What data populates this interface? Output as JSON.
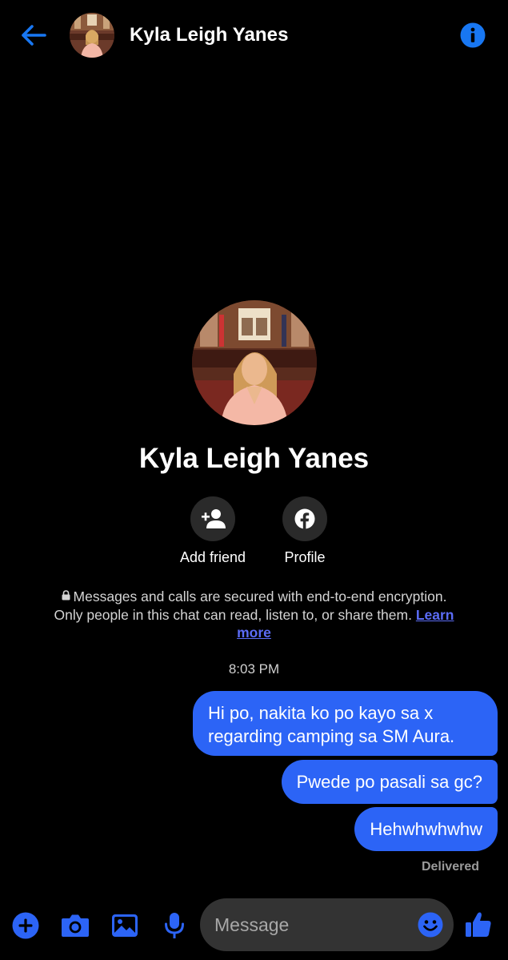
{
  "header": {
    "contact_name": "Kyla Leigh Yanes"
  },
  "profile": {
    "name": "Kyla Leigh Yanes",
    "actions": [
      {
        "label": "Add friend",
        "icon": "add-person-icon"
      },
      {
        "label": "Profile",
        "icon": "facebook-icon"
      }
    ]
  },
  "encryption": {
    "text": "Messages and calls are secured with end-to-end encryption. Only people in this chat can read, listen to, or share them.",
    "link": "Learn more"
  },
  "chat": {
    "timestamp": "8:03 PM",
    "messages": [
      {
        "from": "me",
        "text": "Hi po, nakita ko po kayo sa x regarding camping sa SM Aura."
      },
      {
        "from": "me",
        "text": "Pwede po pasali sa gc?"
      },
      {
        "from": "me",
        "text": "Hehwhwhwhw"
      }
    ],
    "status": "Delivered"
  },
  "composer": {
    "placeholder": "Message"
  },
  "colors": {
    "accent": "#2c64f6",
    "background": "#000000",
    "icon_blue": "#1877f2",
    "link": "#5b6cf6"
  }
}
